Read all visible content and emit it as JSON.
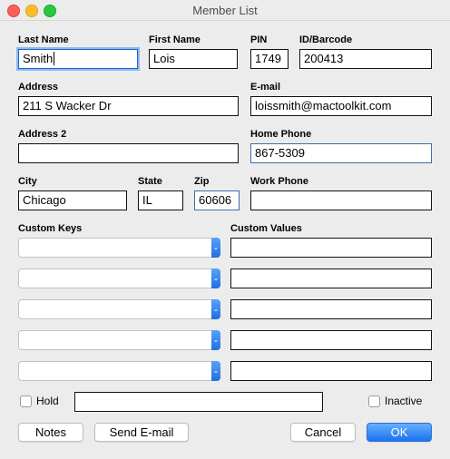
{
  "window": {
    "title": "Member List"
  },
  "labels": {
    "last_name": "Last Name",
    "first_name": "First Name",
    "pin": "PIN",
    "id_barcode": "ID/Barcode",
    "address": "Address",
    "email": "E-mail",
    "address2": "Address 2",
    "home_phone": "Home Phone",
    "city": "City",
    "state": "State",
    "zip": "Zip",
    "work_phone": "Work Phone",
    "custom_keys": "Custom Keys",
    "custom_values": "Custom Values"
  },
  "fields": {
    "last_name": "Smith",
    "first_name": "Lois",
    "pin": "1749",
    "id_barcode": "200413",
    "address": "211 S Wacker Dr",
    "email": "loissmith@mactoolkit.com",
    "address2": "",
    "home_phone": "867-5309",
    "city": "Chicago",
    "state": "IL",
    "zip": "60606",
    "work_phone": "",
    "hold_note": ""
  },
  "custom_rows": [
    {
      "key": "",
      "value": ""
    },
    {
      "key": "",
      "value": ""
    },
    {
      "key": "",
      "value": ""
    },
    {
      "key": "",
      "value": ""
    },
    {
      "key": "",
      "value": ""
    }
  ],
  "checkboxes": {
    "hold": "Hold",
    "inactive": "Inactive"
  },
  "buttons": {
    "notes": "Notes",
    "send_email": "Send E-mail",
    "cancel": "Cancel",
    "ok": "OK"
  },
  "colors": {
    "focus": "#1b63c9",
    "primary_button": "#1a72f0"
  }
}
